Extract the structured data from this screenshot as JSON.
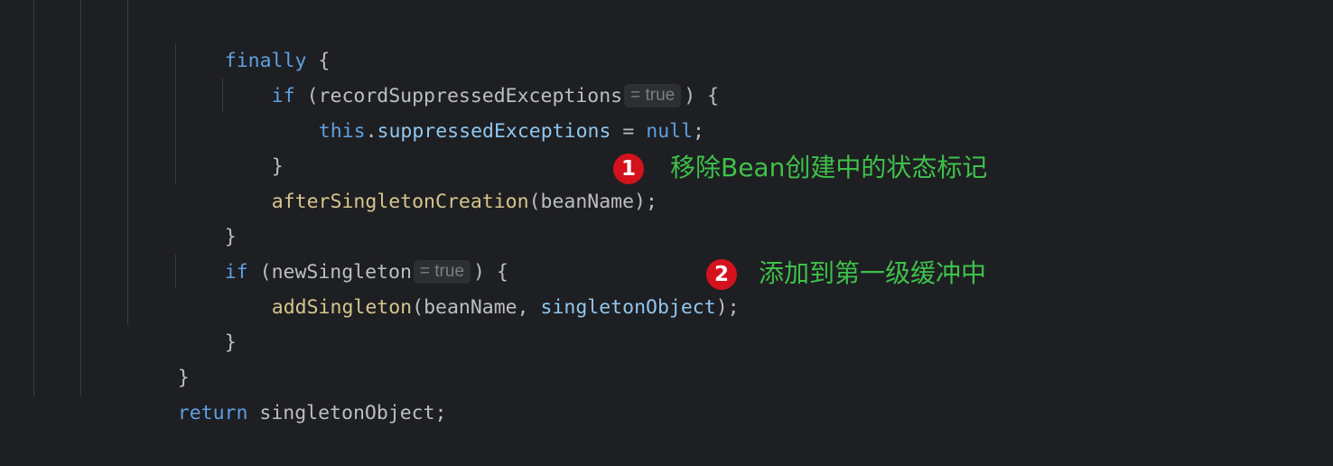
{
  "code": {
    "l1": {
      "keyword": "finally",
      "brace": " {"
    },
    "l2": {
      "keyword": "if",
      "open": " (",
      "ident": "recordSuppressedExceptions",
      "hint": "= true",
      "close": ") {"
    },
    "l3": {
      "keyword": "this",
      "dot": ".",
      "field": "suppressedExceptions",
      "assign": " = ",
      "value": "null",
      "semi": ";"
    },
    "l4": {
      "text": "}"
    },
    "l5": {
      "call": "afterSingletonCreation",
      "args": "(beanName);"
    },
    "l6": {
      "text": "}"
    },
    "l7": {
      "keyword": "if",
      "open": " (",
      "ident": "newSingleton",
      "hint": "= true",
      "close": ") {"
    },
    "l8": {
      "call": "addSingleton",
      "args_start": "(beanName, ",
      "arg_field": "singletonObject",
      "args_end": ");"
    },
    "l9": {
      "text": "}"
    },
    "l10": {
      "text": "}"
    },
    "l11": {
      "keyword": "return",
      "rest": " singletonObject;"
    }
  },
  "annotations": [
    {
      "number": "1",
      "text": "移除Bean创建中的状态标记"
    },
    {
      "number": "2",
      "text": "添加到第一级缓冲中"
    }
  ],
  "colors": {
    "background": "#1e1f22",
    "keyword": "#5f9fe0",
    "method": "#d6c58c",
    "field": "#8fc7ef",
    "text": "#bcbec4",
    "annotation": "#3ec14a",
    "badge": "#d4121d"
  }
}
